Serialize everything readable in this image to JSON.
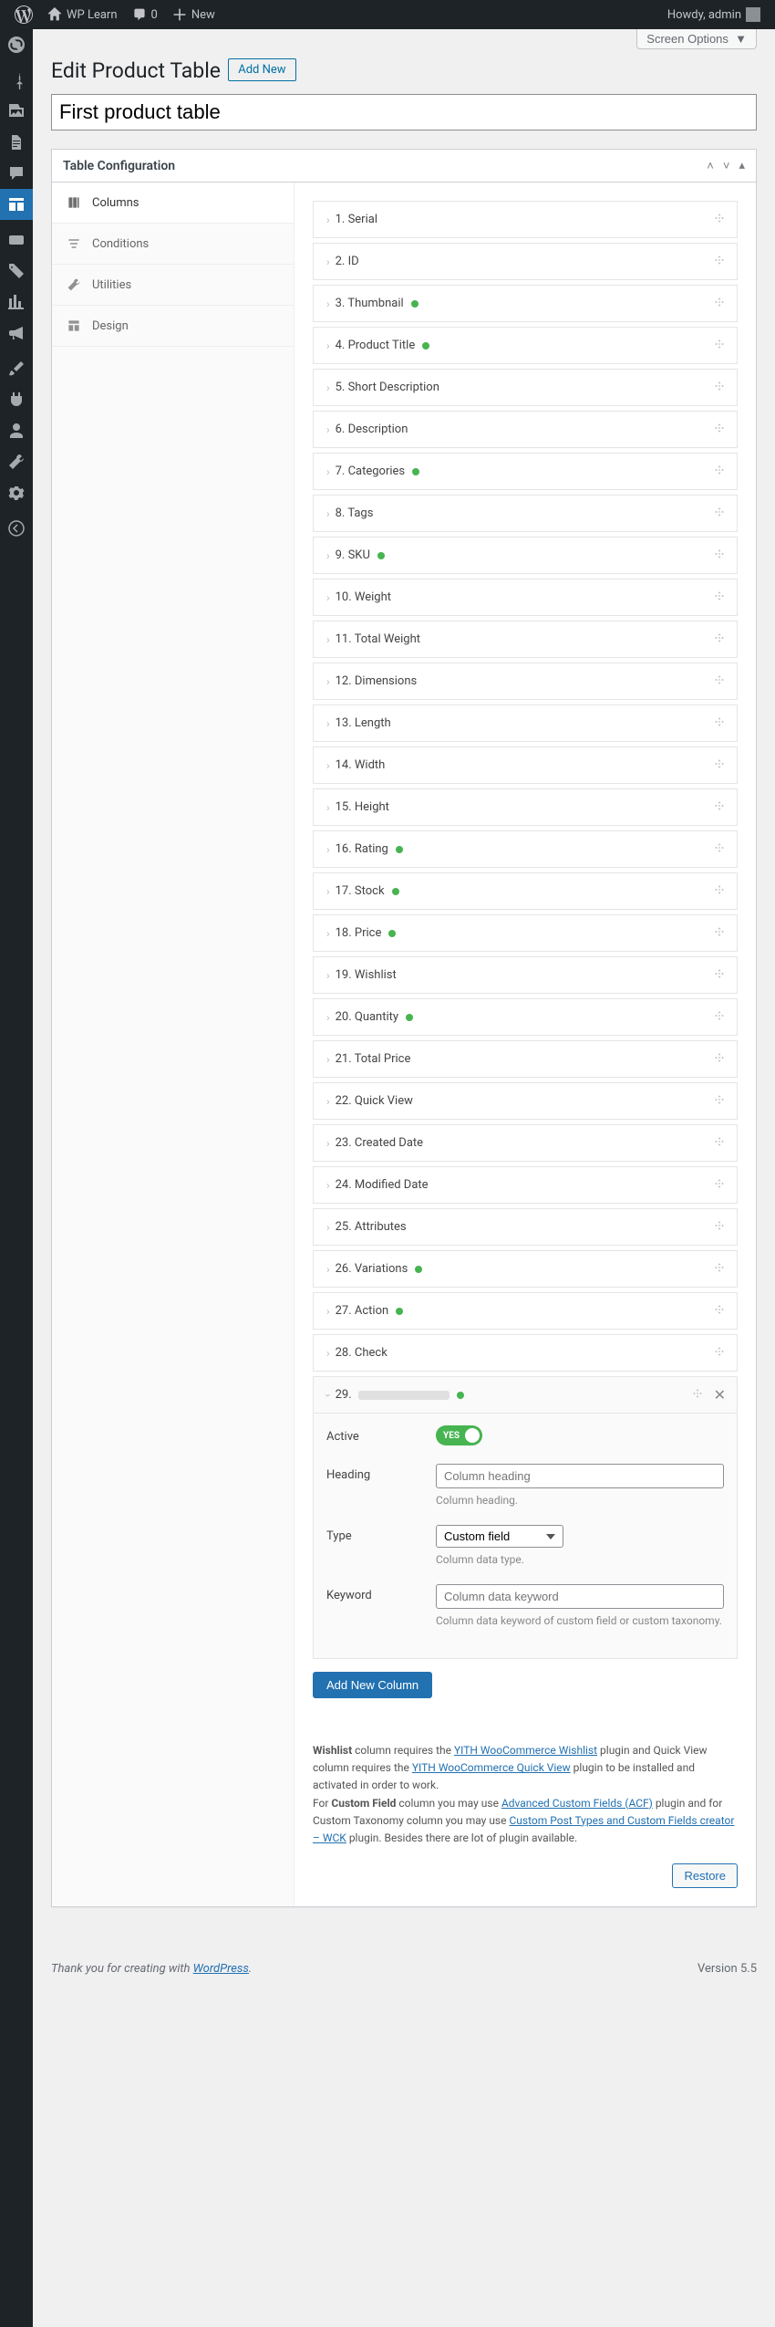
{
  "adminbar": {
    "site": "WP Learn",
    "comments": "0",
    "new": "New",
    "howdy": "Howdy, admin"
  },
  "screen_options": "Screen Options",
  "page_title": "Edit Product Table",
  "add_new": "Add New",
  "title_value": "First product table",
  "postbox_title": "Table Configuration",
  "tabs": {
    "columns": "Columns",
    "conditions": "Conditions",
    "utilities": "Utilities",
    "design": "Design"
  },
  "columns": [
    {
      "n": "1",
      "label": "Serial",
      "dot": false
    },
    {
      "n": "2",
      "label": "ID",
      "dot": false
    },
    {
      "n": "3",
      "label": "Thumbnail",
      "dot": true
    },
    {
      "n": "4",
      "label": "Product Title",
      "dot": true
    },
    {
      "n": "5",
      "label": "Short Description",
      "dot": false
    },
    {
      "n": "6",
      "label": "Description",
      "dot": false
    },
    {
      "n": "7",
      "label": "Categories",
      "dot": true
    },
    {
      "n": "8",
      "label": "Tags",
      "dot": false
    },
    {
      "n": "9",
      "label": "SKU",
      "dot": true
    },
    {
      "n": "10",
      "label": "Weight",
      "dot": false
    },
    {
      "n": "11",
      "label": "Total Weight",
      "dot": false
    },
    {
      "n": "12",
      "label": "Dimensions",
      "dot": false
    },
    {
      "n": "13",
      "label": "Length",
      "dot": false
    },
    {
      "n": "14",
      "label": "Width",
      "dot": false
    },
    {
      "n": "15",
      "label": "Height",
      "dot": false
    },
    {
      "n": "16",
      "label": "Rating",
      "dot": true
    },
    {
      "n": "17",
      "label": "Stock",
      "dot": true
    },
    {
      "n": "18",
      "label": "Price",
      "dot": true
    },
    {
      "n": "19",
      "label": "Wishlist",
      "dot": false
    },
    {
      "n": "20",
      "label": "Quantity",
      "dot": true
    },
    {
      "n": "21",
      "label": "Total Price",
      "dot": false
    },
    {
      "n": "22",
      "label": "Quick View",
      "dot": false
    },
    {
      "n": "23",
      "label": "Created Date",
      "dot": false
    },
    {
      "n": "24",
      "label": "Modified Date",
      "dot": false
    },
    {
      "n": "25",
      "label": "Attributes",
      "dot": false
    },
    {
      "n": "26",
      "label": "Variations",
      "dot": true
    },
    {
      "n": "27",
      "label": "Action",
      "dot": true
    },
    {
      "n": "28",
      "label": "Check",
      "dot": false
    }
  ],
  "expanded_n": "29",
  "form": {
    "active_label": "Active",
    "active_toggle": "YES",
    "heading_label": "Heading",
    "heading_placeholder": "Column heading",
    "heading_desc": "Column heading.",
    "type_label": "Type",
    "type_value": "Custom field",
    "type_desc": "Column data type.",
    "keyword_label": "Keyword",
    "keyword_placeholder": "Column data keyword",
    "keyword_desc": "Column data keyword of custom field or custom taxonomy."
  },
  "add_column_btn": "Add New Column",
  "info": {
    "t1a": "Wishlist",
    "t1b": " column requires the ",
    "l1": "YITH WooCommerce Wishlist",
    "t1c": " plugin and Quick View column requires the ",
    "l2": "YITH WooCommerce Quick View",
    "t1d": " plugin to be installed and activated in order to work.",
    "t2a": "For ",
    "t2b": "Custom Field",
    "t2c": " column you may use ",
    "l3": "Advanced Custom Fields (ACF)",
    "t2d": " plugin and for Custom Taxonomy column you may use ",
    "l4": "Custom Post Types and Custom Fields creator – WCK",
    "t2e": " plugin. Besides there are lot of plugin available."
  },
  "restore": "Restore",
  "footer": {
    "thank": "Thank you for creating with ",
    "wp": "WordPress",
    "dot": ".",
    "version": "Version 5.5"
  }
}
